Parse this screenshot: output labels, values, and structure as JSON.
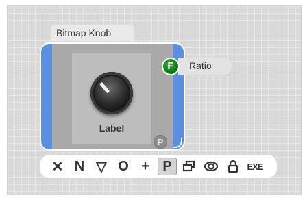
{
  "widget": {
    "title": "Bitmap Knob",
    "knob_label": "Label",
    "badge_f": "F",
    "badge_p": "P",
    "property": "Ratio",
    "accent_color": "#5b8fe0",
    "f_badge_color": "#137a13"
  },
  "toolbar": {
    "buttons": [
      {
        "name": "delete",
        "label": "✕",
        "icon": "close-icon"
      },
      {
        "name": "name",
        "label": "N",
        "icon": "n-icon"
      },
      {
        "name": "filter",
        "label": "▽",
        "icon": "triangle-down-icon"
      },
      {
        "name": "circle",
        "label": "O",
        "icon": "circle-icon"
      },
      {
        "name": "add",
        "label": "+",
        "icon": "plus-icon"
      },
      {
        "name": "property",
        "label": "P",
        "icon": "p-icon",
        "active": true
      },
      {
        "name": "window",
        "label": "",
        "icon": "window-icon"
      },
      {
        "name": "view",
        "label": "",
        "icon": "eye-icon"
      },
      {
        "name": "lock",
        "label": "",
        "icon": "lock-icon"
      },
      {
        "name": "exe",
        "label": "EXE",
        "icon": "exe-icon"
      }
    ]
  }
}
